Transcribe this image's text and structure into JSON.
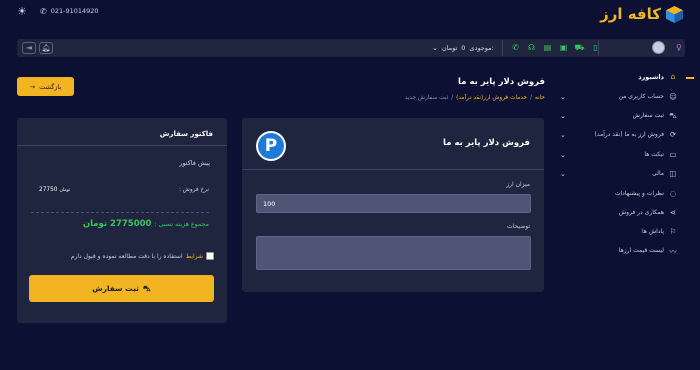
{
  "topbar": {
    "theme_icon": "sun-icon",
    "phone_icon": "phone-icon",
    "phone": "021-91014920",
    "logo_text": "کافه ارز"
  },
  "toolbar": {
    "logout_icon": "logout-icon",
    "bell_icon": "bell-icon",
    "balance_label": "موجودی:",
    "balance_value": "0",
    "balance_unit": "تومان",
    "quick_icons": [
      "phone-icon",
      "headset-icon",
      "document-icon",
      "id-card-icon",
      "car-icon",
      "mobile-icon"
    ]
  },
  "sidebar": {
    "items": [
      {
        "label": "داشبورد",
        "icon": "home-icon",
        "active": true,
        "chevron": false
      },
      {
        "label": "حساب کاربری من",
        "icon": "user-icon",
        "active": false,
        "chevron": true
      },
      {
        "label": "ثبت سفارش",
        "icon": "cart-icon",
        "active": false,
        "chevron": true
      },
      {
        "label": "فروش ارز به ما (نقد درآمد)",
        "icon": "refresh-icon",
        "active": false,
        "chevron": true
      },
      {
        "label": "تیکت ها",
        "icon": "chat-icon",
        "active": false,
        "chevron": true
      },
      {
        "label": "مالی",
        "icon": "wallet-icon",
        "active": false,
        "chevron": true
      },
      {
        "label": "نظرات و پیشنهادات",
        "icon": "comment-icon",
        "active": false,
        "chevron": false
      },
      {
        "label": "همکاری در فروش",
        "icon": "share-icon",
        "active": false,
        "chevron": false
      },
      {
        "label": "پاداش ها",
        "icon": "gift-icon",
        "active": false,
        "chevron": false
      },
      {
        "label": "لیست قیمت ارزها",
        "icon": "chart-icon",
        "active": false,
        "chevron": false
      }
    ]
  },
  "header": {
    "back_label": "بازگشت",
    "title": "فروش دلار پایر به ما",
    "breadcrumb": {
      "home": "خانه",
      "section": "خدمات فروش ارز(نقد درآمد)",
      "current": "ثبت سفارش جدید",
      "sep": "/"
    }
  },
  "form": {
    "badge_letter": "P",
    "title": "فروش دلار پایر به ما",
    "amount_label": "میزان ارز",
    "amount_value": "100",
    "desc_label": "توضیحات"
  },
  "invoice": {
    "title": "فاکتور سفارش",
    "subtitle": "پیش فاکتور",
    "rate_label": "نرخ فروش :",
    "rate_value": "27750",
    "rate_unit": "تومان",
    "total_label": "مجموع هزینه نسبی :",
    "total_value": "2775000 تومان",
    "terms_link": "شرایط",
    "terms_text": "استفاده را با دقت مطالعه نموده و قبول دارم",
    "submit_label": "ثبت سفارش"
  },
  "colors": {
    "background": "#0c1032",
    "card": "#20253f",
    "accent": "#f2b521",
    "success": "#37c759",
    "badge_blue": "#1f7ad6"
  }
}
